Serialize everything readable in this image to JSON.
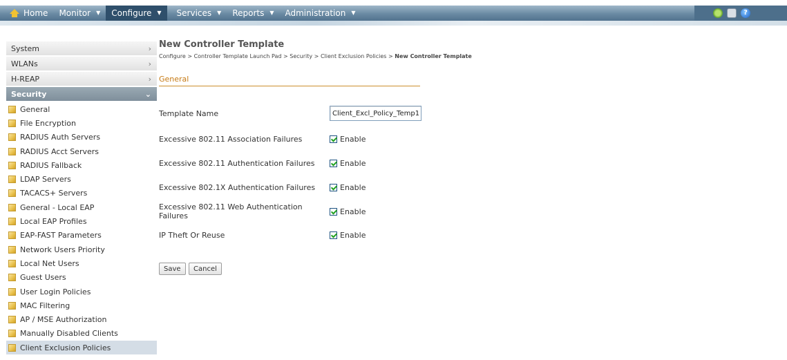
{
  "nav": {
    "items": [
      {
        "label": "Home",
        "has_caret": false
      },
      {
        "label": "Monitor",
        "has_caret": true
      },
      {
        "label": "Configure",
        "has_caret": true,
        "active": true
      },
      {
        "label": "Services",
        "has_caret": true
      },
      {
        "label": "Reports",
        "has_caret": true
      },
      {
        "label": "Administration",
        "has_caret": true
      }
    ],
    "tools": [
      "favorites-icon",
      "print-icon",
      "help-icon"
    ]
  },
  "sidebar": {
    "sections": [
      {
        "label": "System"
      },
      {
        "label": "WLANs"
      },
      {
        "label": "H-REAP"
      },
      {
        "label": "Security",
        "open": true
      }
    ],
    "security_items": [
      "General",
      "File Encryption",
      "RADIUS Auth Servers",
      "RADIUS Acct Servers",
      "RADIUS Fallback",
      "LDAP Servers",
      "TACACS+ Servers",
      "General - Local EAP",
      "Local EAP Profiles",
      "EAP-FAST Parameters",
      "Network Users Priority",
      "Local Net Users",
      "Guest Users",
      "User Login Policies",
      "MAC Filtering",
      "AP / MSE Authorization",
      "Manually Disabled Clients",
      "Client Exclusion Policies"
    ],
    "selected": "Client Exclusion Policies"
  },
  "main": {
    "title": "New Controller Template",
    "breadcrumb": [
      "Configure",
      "Controller Template Launch Pad",
      "Security",
      "Client Exclusion Policies"
    ],
    "breadcrumb_sep": " > ",
    "breadcrumb_current": "New Controller Template",
    "group_title": "General",
    "template_name_label": "Template Name",
    "template_name_value": "Client_Excl_Policy_Temp1",
    "options": [
      {
        "label": "Excessive 802.11 Association Failures",
        "checkbox": "Enable",
        "checked": true
      },
      {
        "label": "Excessive 802.11 Authentication Failures",
        "checkbox": "Enable",
        "checked": true
      },
      {
        "label": "Excessive 802.1X Authentication Failures",
        "checkbox": "Enable",
        "checked": true
      },
      {
        "label": "Excessive 802.11 Web Authentication Failures",
        "checkbox": "Enable",
        "checked": true
      },
      {
        "label": "IP Theft Or Reuse",
        "checkbox": "Enable",
        "checked": true
      }
    ],
    "save_label": "Save",
    "cancel_label": "Cancel"
  }
}
